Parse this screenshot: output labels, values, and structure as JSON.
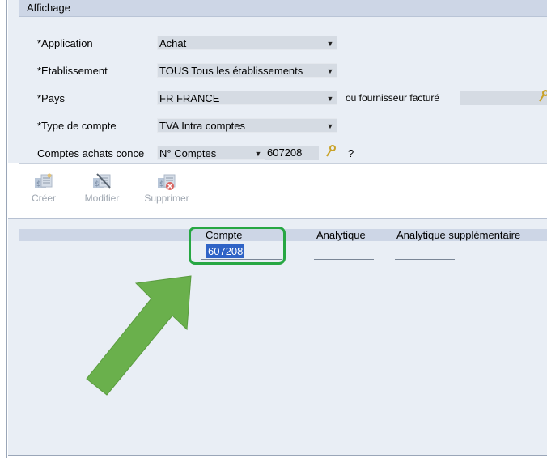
{
  "filter": {
    "section_title": "Affichage",
    "application": {
      "label": "*Application",
      "value": "Achat"
    },
    "etablissement": {
      "label": "*Etablissement",
      "value": "TOUS  Tous les établissements"
    },
    "pays": {
      "label": "*Pays",
      "value": "FR   FRANCE",
      "fournisseur_label": "ou fournisseur facturé",
      "fournisseur_value": ""
    },
    "type_compte": {
      "label": "*Type de compte",
      "value": "TVA Intra comptes"
    },
    "comptes": {
      "label": "Comptes achats conce",
      "select_value": "N° Comptes",
      "input_value": "607208",
      "help": "?"
    }
  },
  "toolbar": {
    "create": "Créer",
    "modify": "Modifier",
    "delete": "Supprimer"
  },
  "grid": {
    "columns": [
      "Compte",
      "Analytique",
      "Analytique supplémentaire"
    ],
    "rows": [
      {
        "compte": "607208",
        "analytique": "",
        "analytique_supp": ""
      }
    ]
  },
  "colors": {
    "highlight": "#27a743",
    "arrow": "#6ab04c",
    "selection": "#2f63c6"
  }
}
